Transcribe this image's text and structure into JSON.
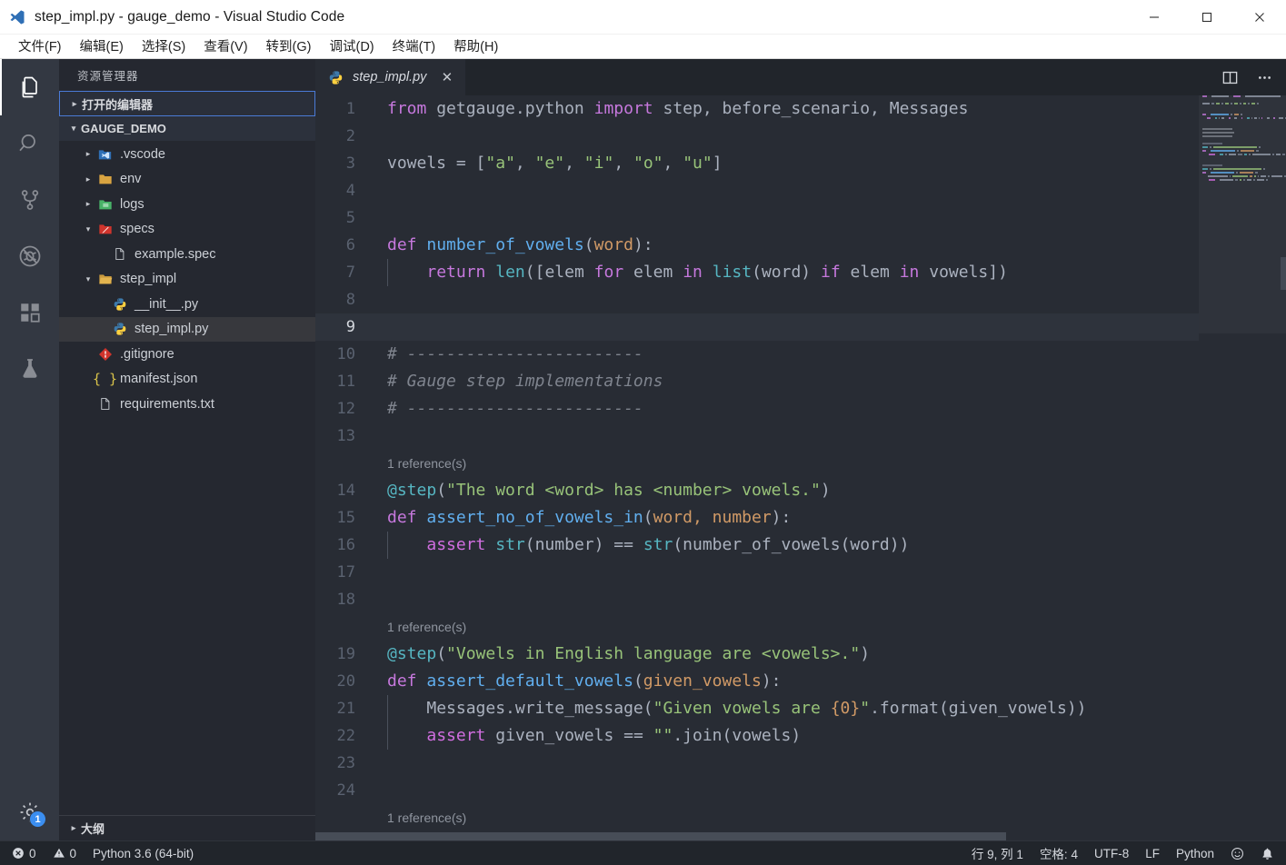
{
  "window": {
    "title": "step_impl.py - gauge_demo - Visual Studio Code",
    "app_icon": "vscode-logo-icon",
    "minimize_label": "—",
    "maximize_label": "□",
    "close_label": "✕"
  },
  "menubar": {
    "items": [
      {
        "label": "文件(F)",
        "name": "menu-file"
      },
      {
        "label": "编辑(E)",
        "name": "menu-edit"
      },
      {
        "label": "选择(S)",
        "name": "menu-selection"
      },
      {
        "label": "查看(V)",
        "name": "menu-view"
      },
      {
        "label": "转到(G)",
        "name": "menu-go"
      },
      {
        "label": "调试(D)",
        "name": "menu-debug"
      },
      {
        "label": "终端(T)",
        "name": "menu-terminal"
      },
      {
        "label": "帮助(H)",
        "name": "menu-help"
      }
    ]
  },
  "activitybar": {
    "items": [
      {
        "icon": "files-explorer-icon",
        "active": true
      },
      {
        "icon": "search-icon",
        "active": false
      },
      {
        "icon": "source-control-branch-icon",
        "active": false
      },
      {
        "icon": "debug-run-icon",
        "active": false
      },
      {
        "icon": "extensions-blocks-icon",
        "active": false
      },
      {
        "icon": "testing-flask-icon",
        "active": false
      }
    ],
    "manage": {
      "icon": "gear-icon",
      "badge": "1"
    }
  },
  "sidebar": {
    "title": "资源管理器",
    "open_editors_label": "打开的编辑器",
    "project_label": "GAUGE_DEMO",
    "outline_label": "大纲",
    "tree": [
      {
        "label": ".vscode",
        "icon": "folder-vscode-icon",
        "indent": 1,
        "twisty": "collapsed",
        "selected": false
      },
      {
        "label": "env",
        "icon": "folder-icon",
        "indent": 1,
        "twisty": "collapsed",
        "selected": false
      },
      {
        "label": "logs",
        "icon": "folder-logs-icon",
        "indent": 1,
        "twisty": "collapsed",
        "selected": false
      },
      {
        "label": "specs",
        "icon": "folder-specs-icon",
        "indent": 1,
        "twisty": "expanded",
        "selected": false
      },
      {
        "label": "example.spec",
        "icon": "file-icon",
        "indent": 2,
        "twisty": "none",
        "selected": false
      },
      {
        "label": "step_impl",
        "icon": "folder-open-icon",
        "indent": 1,
        "twisty": "expanded",
        "selected": false
      },
      {
        "label": "__init__.py",
        "icon": "python-file-icon",
        "indent": 2,
        "twisty": "none",
        "selected": false
      },
      {
        "label": "step_impl.py",
        "icon": "python-file-icon",
        "indent": 2,
        "twisty": "none",
        "selected": true
      },
      {
        "label": ".gitignore",
        "icon": "git-icon",
        "indent": 1,
        "twisty": "none",
        "selected": false
      },
      {
        "label": "manifest.json",
        "icon": "json-braces-icon",
        "indent": 1,
        "twisty": "none",
        "selected": false
      },
      {
        "label": "requirements.txt",
        "icon": "file-icon",
        "indent": 1,
        "twisty": "none",
        "selected": false
      }
    ]
  },
  "editor": {
    "tab": {
      "label": "step_impl.py",
      "icon": "python-file-icon",
      "close": "✕"
    },
    "actions": [
      {
        "icon": "split-editor-icon"
      },
      {
        "icon": "more-actions-ellipsis-icon"
      }
    ],
    "codelens_label": "1 reference(s)",
    "active_line": 9,
    "lines": [
      {
        "n": 1,
        "tokens": [
          [
            "kw",
            "from"
          ],
          [
            "op",
            " "
          ],
          [
            "var",
            "getgauge.python"
          ],
          [
            "op",
            " "
          ],
          [
            "kw",
            "import"
          ],
          [
            "op",
            " "
          ],
          [
            "var",
            "step, before_scenario, Messages"
          ]
        ]
      },
      {
        "n": 2,
        "tokens": []
      },
      {
        "n": 3,
        "tokens": [
          [
            "var",
            "vowels"
          ],
          [
            "op",
            " = ["
          ],
          [
            "str",
            "\"a\""
          ],
          [
            "op",
            ", "
          ],
          [
            "str",
            "\"e\""
          ],
          [
            "op",
            ", "
          ],
          [
            "str",
            "\"i\""
          ],
          [
            "op",
            ", "
          ],
          [
            "str",
            "\"o\""
          ],
          [
            "op",
            ", "
          ],
          [
            "str",
            "\"u\""
          ],
          [
            "op",
            "]"
          ]
        ]
      },
      {
        "n": 4,
        "tokens": []
      },
      {
        "n": 5,
        "tokens": []
      },
      {
        "n": 6,
        "tokens": [
          [
            "kw",
            "def"
          ],
          [
            "op",
            " "
          ],
          [
            "fn",
            "number_of_vowels"
          ],
          [
            "op",
            "("
          ],
          [
            "par",
            "word"
          ],
          [
            "op",
            "):"
          ]
        ]
      },
      {
        "n": 7,
        "tokens": [
          [
            "op",
            "    "
          ],
          [
            "kw",
            "return"
          ],
          [
            "op",
            " "
          ],
          [
            "fn2",
            "len"
          ],
          [
            "op",
            "(["
          ],
          [
            "var",
            "elem"
          ],
          [
            "op",
            " "
          ],
          [
            "kw",
            "for"
          ],
          [
            "op",
            " "
          ],
          [
            "var",
            "elem"
          ],
          [
            "op",
            " "
          ],
          [
            "kw",
            "in"
          ],
          [
            "op",
            " "
          ],
          [
            "fn2",
            "list"
          ],
          [
            "op",
            "("
          ],
          [
            "var",
            "word"
          ],
          [
            "op",
            ") "
          ],
          [
            "kw",
            "if"
          ],
          [
            "op",
            " "
          ],
          [
            "var",
            "elem"
          ],
          [
            "op",
            " "
          ],
          [
            "kw",
            "in"
          ],
          [
            "op",
            " "
          ],
          [
            "var",
            "vowels"
          ],
          [
            "op",
            "])"
          ]
        ],
        "indent_guide": true
      },
      {
        "n": 8,
        "tokens": []
      },
      {
        "n": 9,
        "tokens": []
      },
      {
        "n": 10,
        "tokens": [
          [
            "cmt",
            "# ------------------------"
          ]
        ]
      },
      {
        "n": 11,
        "tokens": [
          [
            "cmt",
            "# Gauge step implementations"
          ]
        ]
      },
      {
        "n": 12,
        "tokens": [
          [
            "cmt",
            "# ------------------------"
          ]
        ]
      },
      {
        "n": 13,
        "tokens": []
      },
      {
        "n": 14,
        "codelens": true,
        "tokens": [
          [
            "at",
            "@step"
          ],
          [
            "op",
            "("
          ],
          [
            "str",
            "\"The word <word> has <number> vowels.\""
          ],
          [
            "op",
            ")"
          ]
        ]
      },
      {
        "n": 15,
        "tokens": [
          [
            "kw",
            "def"
          ],
          [
            "op",
            " "
          ],
          [
            "fn",
            "assert_no_of_vowels_in"
          ],
          [
            "op",
            "("
          ],
          [
            "par",
            "word, number"
          ],
          [
            "op",
            "):"
          ]
        ]
      },
      {
        "n": 16,
        "tokens": [
          [
            "op",
            "    "
          ],
          [
            "kw2",
            "assert"
          ],
          [
            "op",
            " "
          ],
          [
            "fn2",
            "str"
          ],
          [
            "op",
            "("
          ],
          [
            "var",
            "number"
          ],
          [
            "op",
            ") == "
          ],
          [
            "fn2",
            "str"
          ],
          [
            "op",
            "("
          ],
          [
            "var",
            "number_of_vowels"
          ],
          [
            "op",
            "("
          ],
          [
            "var",
            "word"
          ],
          [
            "op",
            "))"
          ]
        ],
        "indent_guide": true
      },
      {
        "n": 17,
        "tokens": []
      },
      {
        "n": 18,
        "tokens": []
      },
      {
        "n": 19,
        "codelens": true,
        "tokens": [
          [
            "at",
            "@step"
          ],
          [
            "op",
            "("
          ],
          [
            "str",
            "\"Vowels in English language are <vowels>.\""
          ],
          [
            "op",
            ")"
          ]
        ]
      },
      {
        "n": 20,
        "tokens": [
          [
            "kw",
            "def"
          ],
          [
            "op",
            " "
          ],
          [
            "fn",
            "assert_default_vowels"
          ],
          [
            "op",
            "("
          ],
          [
            "par",
            "given_vowels"
          ],
          [
            "op",
            "):"
          ]
        ]
      },
      {
        "n": 21,
        "tokens": [
          [
            "op",
            "    "
          ],
          [
            "var",
            "Messages.write_message"
          ],
          [
            "op",
            "("
          ],
          [
            "str",
            "\"Given vowels are "
          ],
          [
            "par",
            "{0}"
          ],
          [
            "str",
            "\""
          ],
          [
            "op",
            "."
          ],
          [
            "var",
            "format"
          ],
          [
            "op",
            "("
          ],
          [
            "var",
            "given_vowels"
          ],
          [
            "op",
            "))"
          ]
        ],
        "indent_guide": true
      },
      {
        "n": 22,
        "tokens": [
          [
            "op",
            "    "
          ],
          [
            "kw2",
            "assert"
          ],
          [
            "op",
            " "
          ],
          [
            "var",
            "given_vowels"
          ],
          [
            "op",
            " == "
          ],
          [
            "str",
            "\"\""
          ],
          [
            "op",
            "."
          ],
          [
            "var",
            "join"
          ],
          [
            "op",
            "("
          ],
          [
            "var",
            "vowels"
          ],
          [
            "op",
            ")"
          ]
        ],
        "indent_guide": true
      },
      {
        "n": 23,
        "tokens": []
      },
      {
        "n": 24,
        "tokens": []
      }
    ],
    "trailing_codelens": "1 reference(s)"
  },
  "statusbar": {
    "left": [
      {
        "icon": "error-circle-icon",
        "text": "0",
        "name": "error-count"
      },
      {
        "icon": "warning-triangle-icon",
        "text": "0",
        "name": "warning-count"
      },
      {
        "icon": "none",
        "text": "Python 3.6 (64-bit)",
        "name": "python-interpreter"
      }
    ],
    "right": [
      {
        "icon": "none",
        "text": "行 9, 列 1",
        "name": "cursor-position"
      },
      {
        "icon": "none",
        "text": "空格: 4",
        "name": "indentation"
      },
      {
        "icon": "none",
        "text": "UTF-8",
        "name": "encoding"
      },
      {
        "icon": "none",
        "text": "LF",
        "name": "eol"
      },
      {
        "icon": "none",
        "text": "Python",
        "name": "language-mode"
      },
      {
        "icon": "smiley-feedback-icon",
        "text": "",
        "name": "feedback"
      },
      {
        "icon": "bell-notifications-icon",
        "text": "",
        "name": "notifications"
      }
    ]
  },
  "colors": {
    "titlebar_bg": "#ffffff",
    "activitybar_bg": "#333842",
    "sidebar_bg": "#252830",
    "editor_bg": "#282c34",
    "statusbar_bg": "#21252b",
    "accent_blue": "#3b8ef0",
    "keyword": "#c678dd",
    "string": "#98c379",
    "function": "#61afef",
    "comment": "#7f848e",
    "parameter": "#d19a66"
  }
}
